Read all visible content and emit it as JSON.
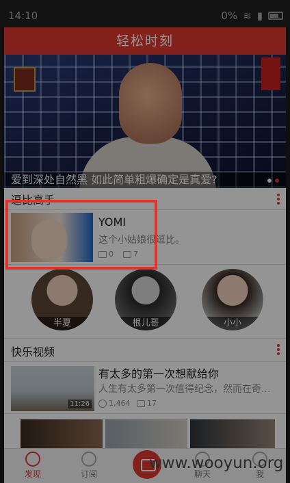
{
  "statusbar": {
    "time": "14:10",
    "battery": "0%"
  },
  "header": {
    "title": "轻松时刻"
  },
  "banner": {
    "caption": "爱到深处自然黑 如此简单粗爆确定是真爱?"
  },
  "section1": {
    "title": "逗比高手"
  },
  "feature": {
    "name": "YOMI",
    "desc": "这个小姑娘很逗比。",
    "likes": "0",
    "comments": "7"
  },
  "avatars": [
    {
      "label": "半夏"
    },
    {
      "label": "根儿哥"
    },
    {
      "label": "小小"
    }
  ],
  "section2": {
    "title": "快乐视频"
  },
  "video": {
    "title": "有太多的第一次想献给你",
    "desc": "人生有太多第一次值得纪念，然而在奇...",
    "duration": "11:26",
    "plays": "1,464",
    "comments": "17"
  },
  "tabbar": {
    "discover": "发现",
    "subscribe": "订阅",
    "chat": "聊天",
    "me": "我"
  },
  "watermark": "www.wooyun.org",
  "colors": {
    "accent": "#e23b32",
    "highlight": "#e8302a"
  }
}
